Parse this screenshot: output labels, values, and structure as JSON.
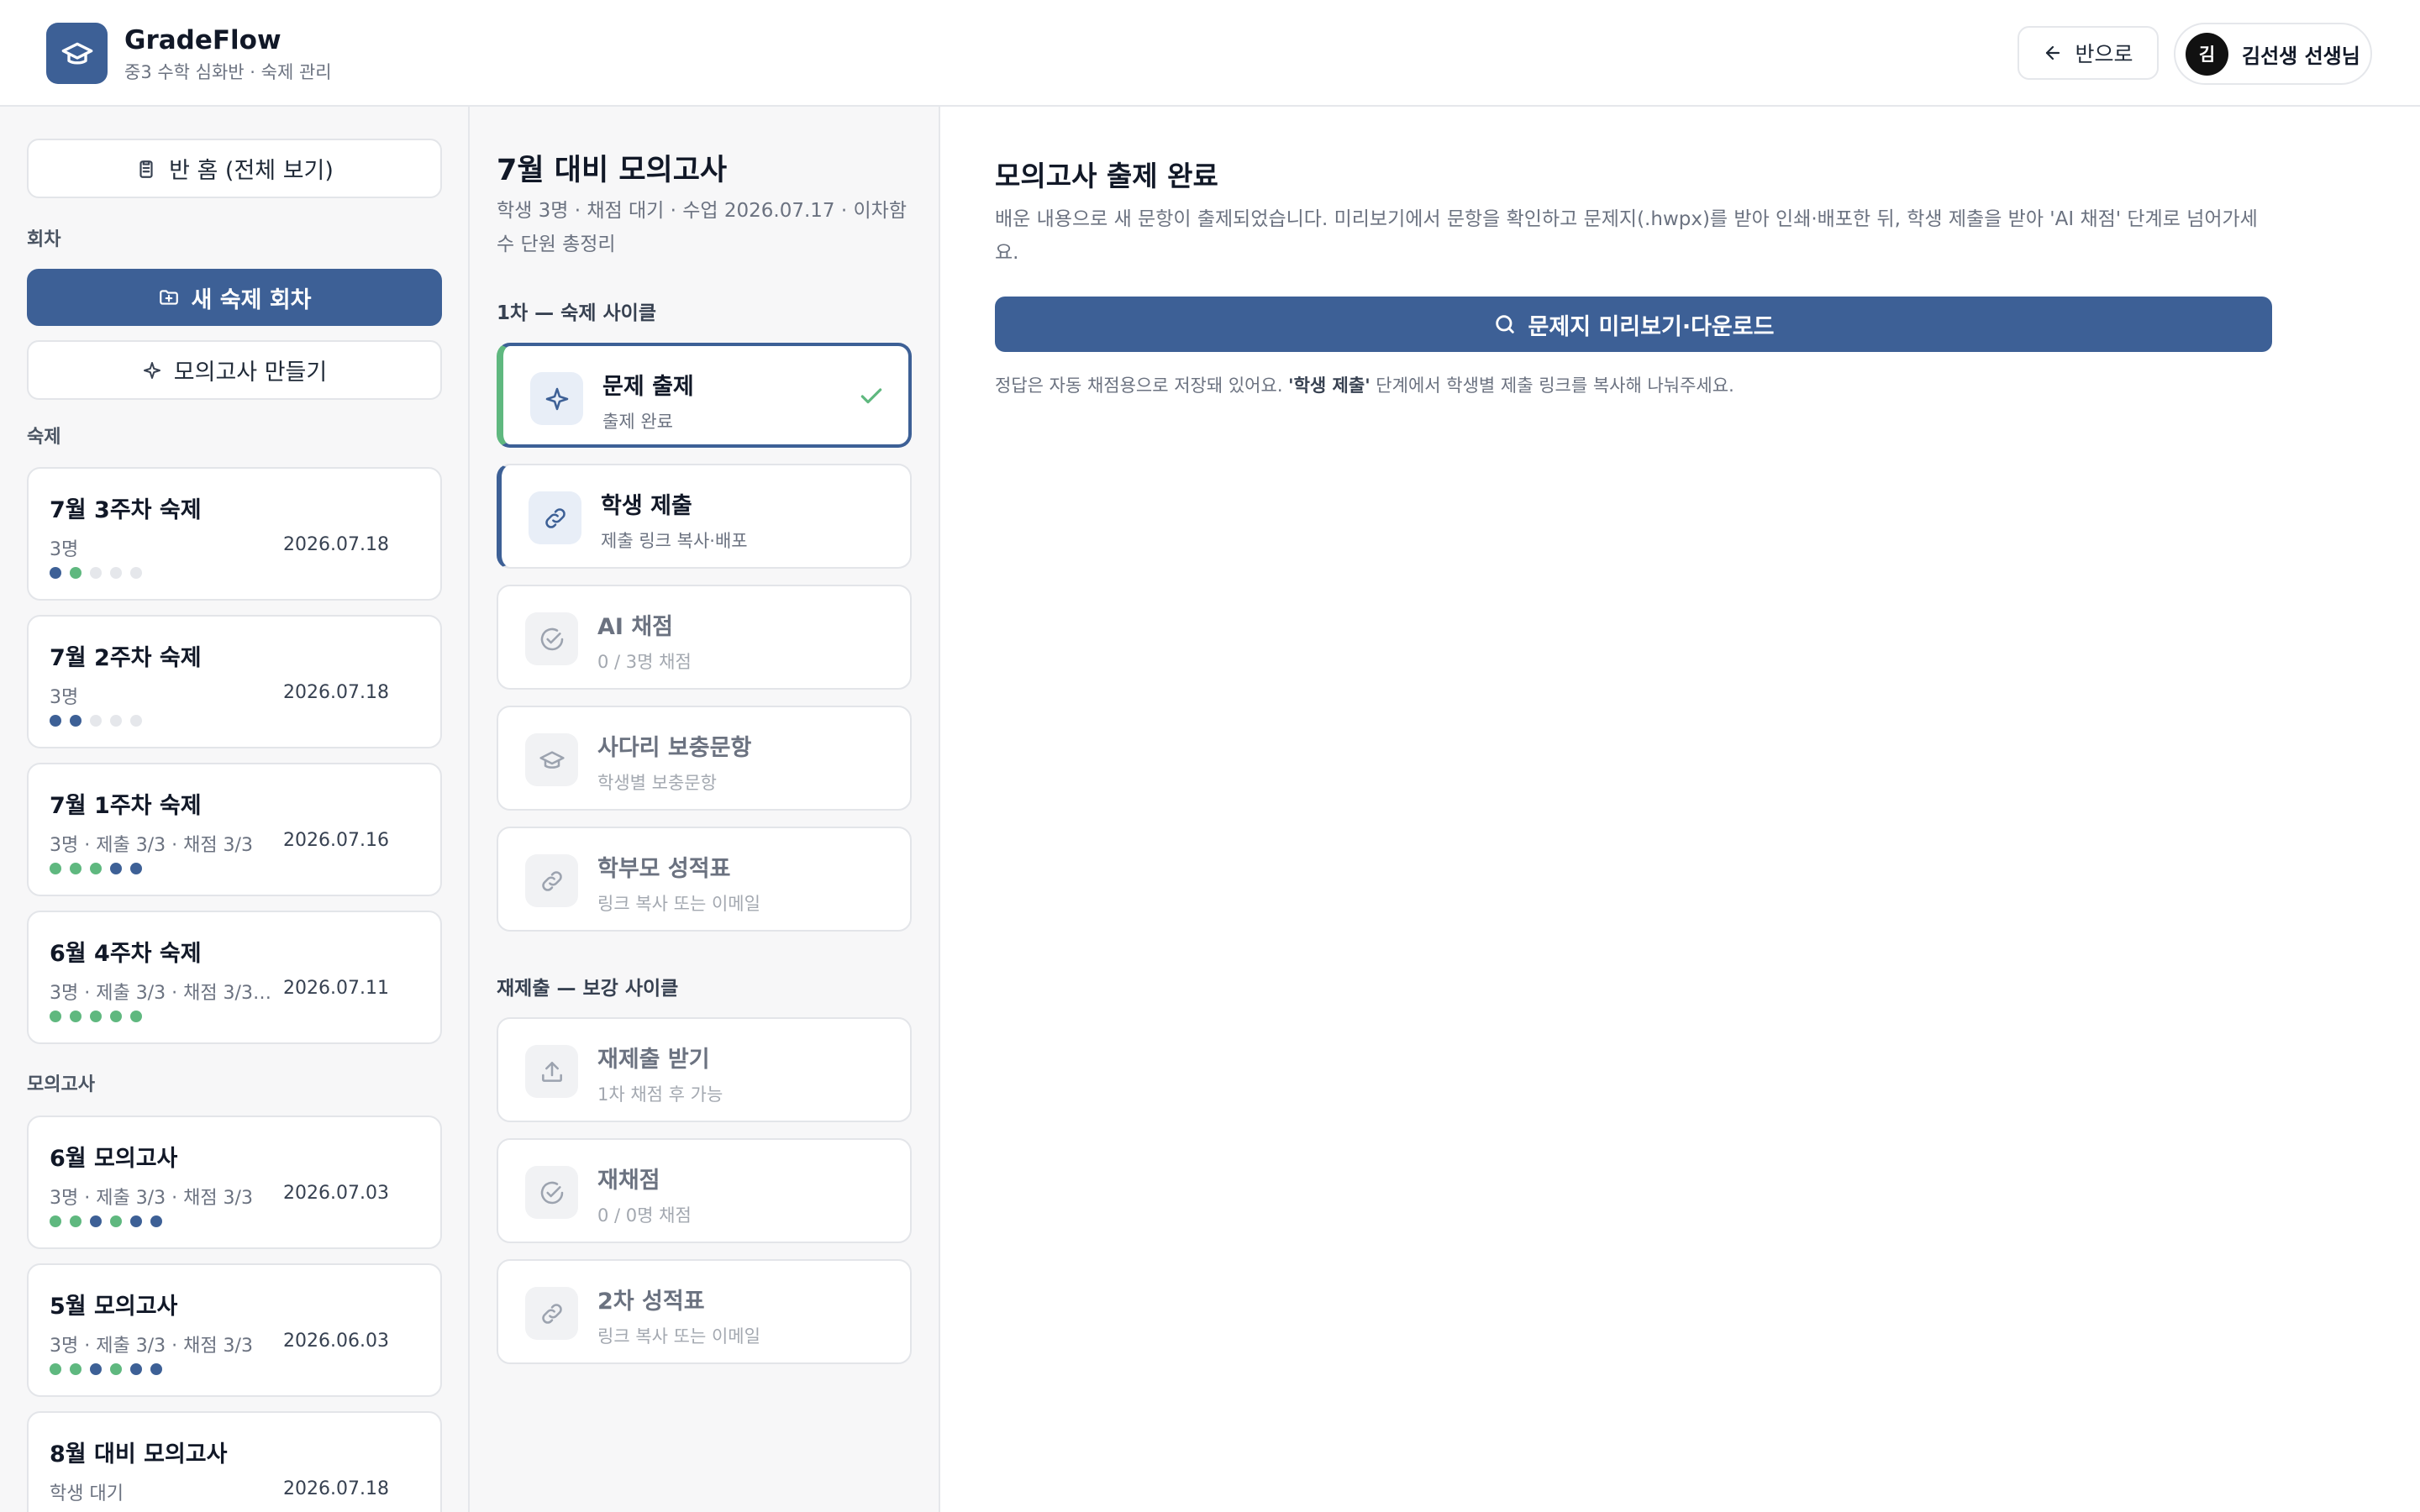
{
  "header": {
    "brand": "GradeFlow",
    "subtitle": "중3 수학 심화반 · 숙제 관리",
    "back_label": "반으로",
    "user_initial": "김",
    "user_name": "김선생 선생님"
  },
  "sidebar": {
    "home_label": "반 홈 (전체 보기)",
    "rounds_label": "회차",
    "new_homework_label": "새 숙제 회차",
    "make_mock_label": "모의고사 만들기",
    "homework_label": "숙제",
    "homeworks": [
      {
        "title": "7월 3주차 숙제",
        "meta": "3명",
        "date": "2026.07.18",
        "dots": [
          "b",
          "g",
          "e",
          "e",
          "e"
        ]
      },
      {
        "title": "7월 2주차 숙제",
        "meta": "3명",
        "date": "2026.07.18",
        "dots": [
          "b",
          "b",
          "e",
          "e",
          "e"
        ]
      },
      {
        "title": "7월 1주차 숙제",
        "meta": "3명 · 제출 3/3 · 채점 3/3",
        "date": "2026.07.16",
        "dots": [
          "g",
          "g",
          "g",
          "b",
          "b"
        ]
      },
      {
        "title": "6월 4주차 숙제",
        "meta": "3명 · 제출 3/3 · 채점 3/3 ·...",
        "date": "2026.07.11",
        "dots": [
          "g",
          "g",
          "g",
          "g",
          "g"
        ]
      }
    ],
    "mock_label": "모의고사",
    "mocks": [
      {
        "title": "6월 모의고사",
        "meta": "3명 · 제출 3/3 · 채점 3/3",
        "date": "2026.07.03",
        "dots": [
          "g",
          "g",
          "b",
          "g",
          "b",
          "b"
        ]
      },
      {
        "title": "5월 모의고사",
        "meta": "3명 · 제출 3/3 · 채점 3/3",
        "date": "2026.06.03",
        "dots": [
          "g",
          "g",
          "b",
          "g",
          "b",
          "b"
        ]
      },
      {
        "title": "8월 대비 모의고사",
        "meta": "학생 대기",
        "date": "2026.07.18",
        "dots": []
      }
    ]
  },
  "middle": {
    "title": "7월 대비 모의고사",
    "subtitle": "학생 3명 · 채점 대기 · 수업 2026.07.17 · 이차함수 단원 총정리",
    "cycle1_label": "1차 — 숙제 사이클",
    "cycle1_steps": [
      {
        "title": "문제 출제",
        "sub": "출제 완료",
        "icon": "sparkle-icon"
      },
      {
        "title": "학생 제출",
        "sub": "제출 링크 복사·배포",
        "icon": "link-icon"
      },
      {
        "title": "AI 채점",
        "sub": "0 / 3명 채점",
        "icon": "check-circle-icon"
      },
      {
        "title": "사다리 보충문항",
        "sub": "학생별 보충문항",
        "icon": "graduation-cap-icon"
      },
      {
        "title": "학부모 성적표",
        "sub": "링크 복사 또는 이메일",
        "icon": "link-icon"
      }
    ],
    "cycle2_label": "재제출 — 보강 사이클",
    "cycle2_steps": [
      {
        "title": "재제출 받기",
        "sub": "1차 채점 후 가능",
        "icon": "upload-icon"
      },
      {
        "title": "재채점",
        "sub": "0 / 0명 채점",
        "icon": "check-circle-icon"
      },
      {
        "title": "2차 성적표",
        "sub": "링크 복사 또는 이메일",
        "icon": "link-icon"
      }
    ]
  },
  "main": {
    "title": "모의고사 출제 완료",
    "description": "배운 내용으로 새 문항이 출제되었습니다. 미리보기에서 문항을 확인하고 문제지(.hwpx)를 받아 인쇄·배포한 뒤, 학생 제출을 받아 'AI 채점' 단계로 넘어가세요.",
    "button_label": "문제지 미리보기·다운로드",
    "note_prefix": "정답은 자동 채점용으로 저장돼 있어요. ",
    "note_bold": "'학생 제출'",
    "note_suffix": " 단계에서 학생별 제출 링크를 복사해 나눠주세요."
  },
  "colors": {
    "primary": "#3d6096",
    "success": "#5fb87f",
    "border": "#e5e7eb",
    "muted": "#6b7280"
  }
}
